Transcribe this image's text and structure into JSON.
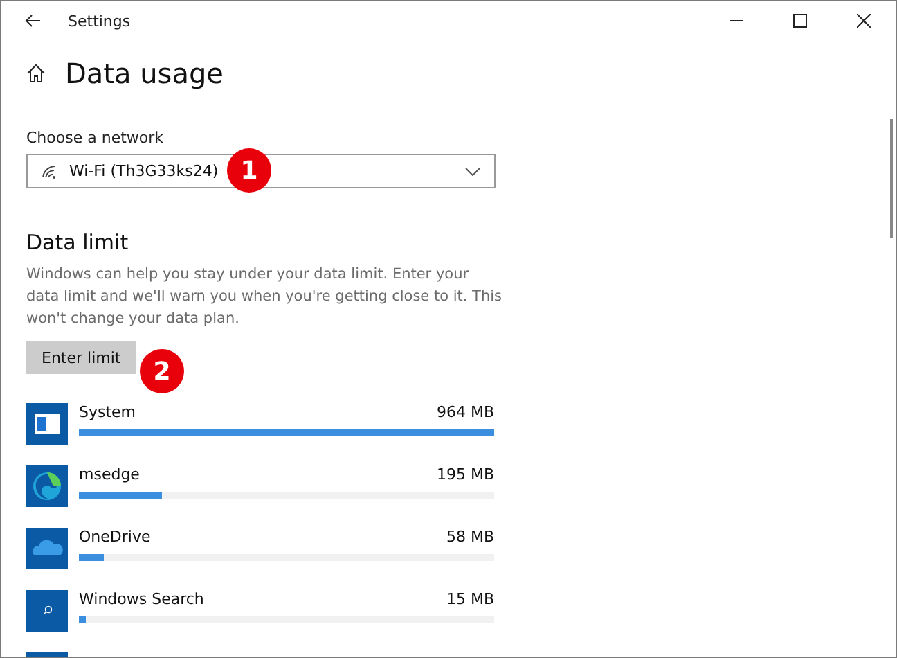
{
  "window": {
    "title": "Settings"
  },
  "page": {
    "title": "Data usage"
  },
  "network": {
    "label": "Choose a network",
    "value": "Wi-Fi (Th3G33ks24)",
    "marker": "1"
  },
  "data_limit": {
    "title": "Data limit",
    "description": "Windows can help you stay under your data limit. Enter your data limit and we'll warn you when you're getting close to it. This won't change your data plan.",
    "button": "Enter limit",
    "marker": "2"
  },
  "apps": [
    {
      "kind": "system",
      "name": "System",
      "usage": "964 MB",
      "level": 1
    },
    {
      "kind": "edge",
      "name": "msedge",
      "usage": "195 MB",
      "level": 0.2
    },
    {
      "kind": "cloud",
      "name": "OneDrive",
      "usage": "58 MB",
      "level": 0.06
    },
    {
      "kind": "search",
      "name": "Windows Search",
      "usage": "15 MB",
      "level": 0.016
    }
  ]
}
